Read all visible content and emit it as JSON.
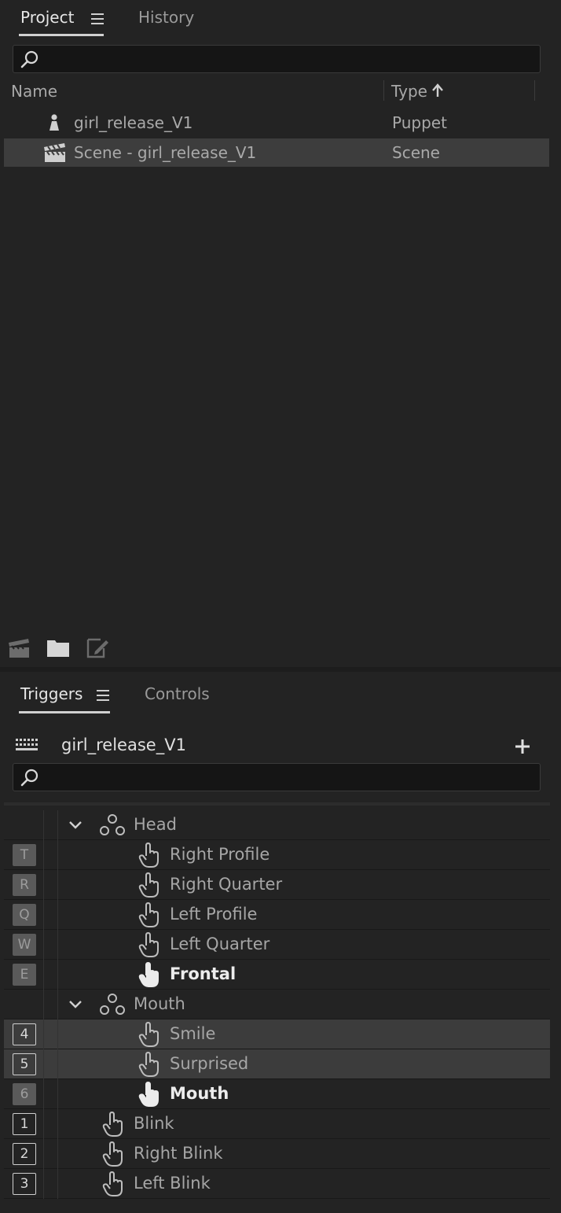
{
  "project": {
    "tabs": {
      "project": "Project",
      "history": "History"
    },
    "search": {
      "value": "",
      "placeholder": ""
    },
    "columns": {
      "name": "Name",
      "type": "Type",
      "type_sort_indicator": "arrow-up-icon"
    },
    "items": [
      {
        "name": "girl_release_V1",
        "type": "Puppet",
        "icon": "puppet-icon",
        "selected": false
      },
      {
        "name": "Scene - girl_release_V1",
        "type": "Scene",
        "icon": "scene-clapper-icon",
        "selected": true
      }
    ],
    "bottom_icons": [
      "new-scene-icon",
      "new-folder-icon",
      "edit-icon"
    ]
  },
  "triggers": {
    "tabs": {
      "triggers": "Triggers",
      "controls": "Controls"
    },
    "puppet_name": "girl_release_V1",
    "add_icon": "plus-icon",
    "keyboard_icon": "keyboard-icon",
    "search": {
      "value": "",
      "placeholder": ""
    },
    "rows": [
      {
        "key": "",
        "label": "Head",
        "type": "swap-set",
        "bold": false,
        "selected": false
      },
      {
        "key": "T",
        "label": "Right Profile",
        "type": "trigger",
        "bold": false,
        "selected": false
      },
      {
        "key": "R",
        "label": "Right Quarter",
        "type": "trigger",
        "bold": false,
        "selected": false
      },
      {
        "key": "Q",
        "label": "Left Profile",
        "type": "trigger",
        "bold": false,
        "selected": false
      },
      {
        "key": "W",
        "label": "Left Quarter",
        "type": "trigger",
        "bold": false,
        "selected": false
      },
      {
        "key": "E",
        "label": "Frontal",
        "type": "trigger",
        "bold": true,
        "selected": false
      },
      {
        "key": "",
        "label": "Mouth",
        "type": "swap-set",
        "bold": false,
        "selected": false
      },
      {
        "key": "4",
        "label": "Smile",
        "type": "trigger",
        "bold": false,
        "selected": true
      },
      {
        "key": "5",
        "label": "Surprised",
        "type": "trigger",
        "bold": false,
        "selected": true
      },
      {
        "key": "6",
        "label": "Mouth",
        "type": "trigger",
        "bold": true,
        "selected": false
      },
      {
        "key": "1",
        "label": "Blink",
        "type": "top-trigger",
        "bold": false,
        "selected": false
      },
      {
        "key": "2",
        "label": "Right Blink",
        "type": "top-trigger",
        "bold": false,
        "selected": false
      },
      {
        "key": "3",
        "label": "Left Blink",
        "type": "top-trigger",
        "bold": false,
        "selected": false
      }
    ]
  }
}
